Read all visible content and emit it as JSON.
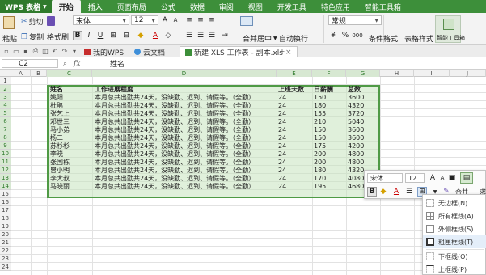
{
  "app": {
    "name": "WPS 表格"
  },
  "menu": [
    "开始",
    "插入",
    "页面布局",
    "公式",
    "数据",
    "审阅",
    "视图",
    "开发工具",
    "特色应用",
    "智能工具箱"
  ],
  "ribbon": {
    "paste": "粘贴",
    "cut": "剪切",
    "copy": "复制",
    "format_painter": "格式刷",
    "font_name": "宋体",
    "font_size": "12",
    "merge_center": "合并居中",
    "wrap_text": "自动换行",
    "number_format": "常规",
    "conditional_format": "条件格式",
    "table_style": "表格样式",
    "smart_toolbox": "智能工具箱"
  },
  "doc_tabs": [
    {
      "label": "我的WPS",
      "active": false
    },
    {
      "label": "云文档",
      "active": false
    },
    {
      "label": "新建 XLS 工作表 - 副本.xls",
      "active": true
    }
  ],
  "formula_bar": {
    "cell_ref": "C2",
    "fx": "fx",
    "content": "姓名"
  },
  "columns": [
    "A",
    "B",
    "C",
    "D",
    "E",
    "F",
    "G",
    "H",
    "I",
    "J"
  ],
  "rows": [
    "1",
    "2",
    "3",
    "4",
    "5",
    "6",
    "7",
    "8",
    "9",
    "10",
    "11",
    "12",
    "13",
    "14",
    "15",
    "16",
    "17",
    "18",
    "19",
    "20",
    "21",
    "22",
    "23",
    "24"
  ],
  "table": {
    "headers": [
      "姓名",
      "工作进展程度",
      "上班天数",
      "日薪酬",
      "总数"
    ],
    "rows": [
      [
        "姚阳",
        "本月总共出勤共24天，没缺勤、迟到、请假等。（全勤）",
        "24",
        "150",
        "3600"
      ],
      [
        "杜鹃",
        "本月总共出勤共24天，没缺勤、迟到、请假等。（全勤）",
        "24",
        "180",
        "4320"
      ],
      [
        "张艺上",
        "本月总共出勤共24天，没缺勤、迟到、请假等。（全勤）",
        "24",
        "155",
        "3720"
      ],
      [
        "邓世三",
        "本月总共出勤共24天，没缺勤、迟到、请假等。（全勤）",
        "24",
        "210",
        "5040"
      ],
      [
        "马小弟",
        "本月总共出勤共24天，没缺勤、迟到、请假等。（全勤）",
        "24",
        "150",
        "3600"
      ],
      [
        "杨二",
        "本月总共出勤共24天，没缺勤、迟到、请假等。（全勤）",
        "24",
        "150",
        "3600"
      ],
      [
        "苏杉杉",
        "本月总共出勤共24天，没缺勤、迟到、请假等。（全勤）",
        "24",
        "175",
        "4200"
      ],
      [
        "李晓",
        "本月总共出勤共24天，没缺勤、迟到、请假等。（全勤）",
        "24",
        "200",
        "4800"
      ],
      [
        "张国栋",
        "本月总共出勤共24天，没缺勤、迟到、请假等。（全勤）",
        "24",
        "200",
        "4800"
      ],
      [
        "曾小明",
        "本月总共出勤共24天，没缺勤、迟到、请假等。（全勤）",
        "24",
        "180",
        "4320"
      ],
      [
        "李大叔",
        "本月总共出勤共24天，没缺勤、迟到、请假等。（全勤）",
        "24",
        "170",
        "4080"
      ],
      [
        "马晓丽",
        "本月总共出勤共24天，没缺勤、迟到、请假等。（全勤）",
        "24",
        "195",
        "4680"
      ]
    ]
  },
  "mini_toolbar": {
    "font_name": "宋体",
    "font_size": "12",
    "bold": "B",
    "merge": "合并",
    "sum": "求和"
  },
  "border_menu": [
    {
      "label": "无边框(N)"
    },
    {
      "label": "所有框线(A)"
    },
    {
      "label": "外侧框线(S)"
    },
    {
      "label": "粗匣框线(T)"
    },
    {
      "label": "下框线(O)"
    },
    {
      "label": "上框线(P)"
    }
  ],
  "colors": {
    "accent": "#3d8f3a",
    "selection": "#c6e4be",
    "selection_border": "#4f9a45"
  }
}
